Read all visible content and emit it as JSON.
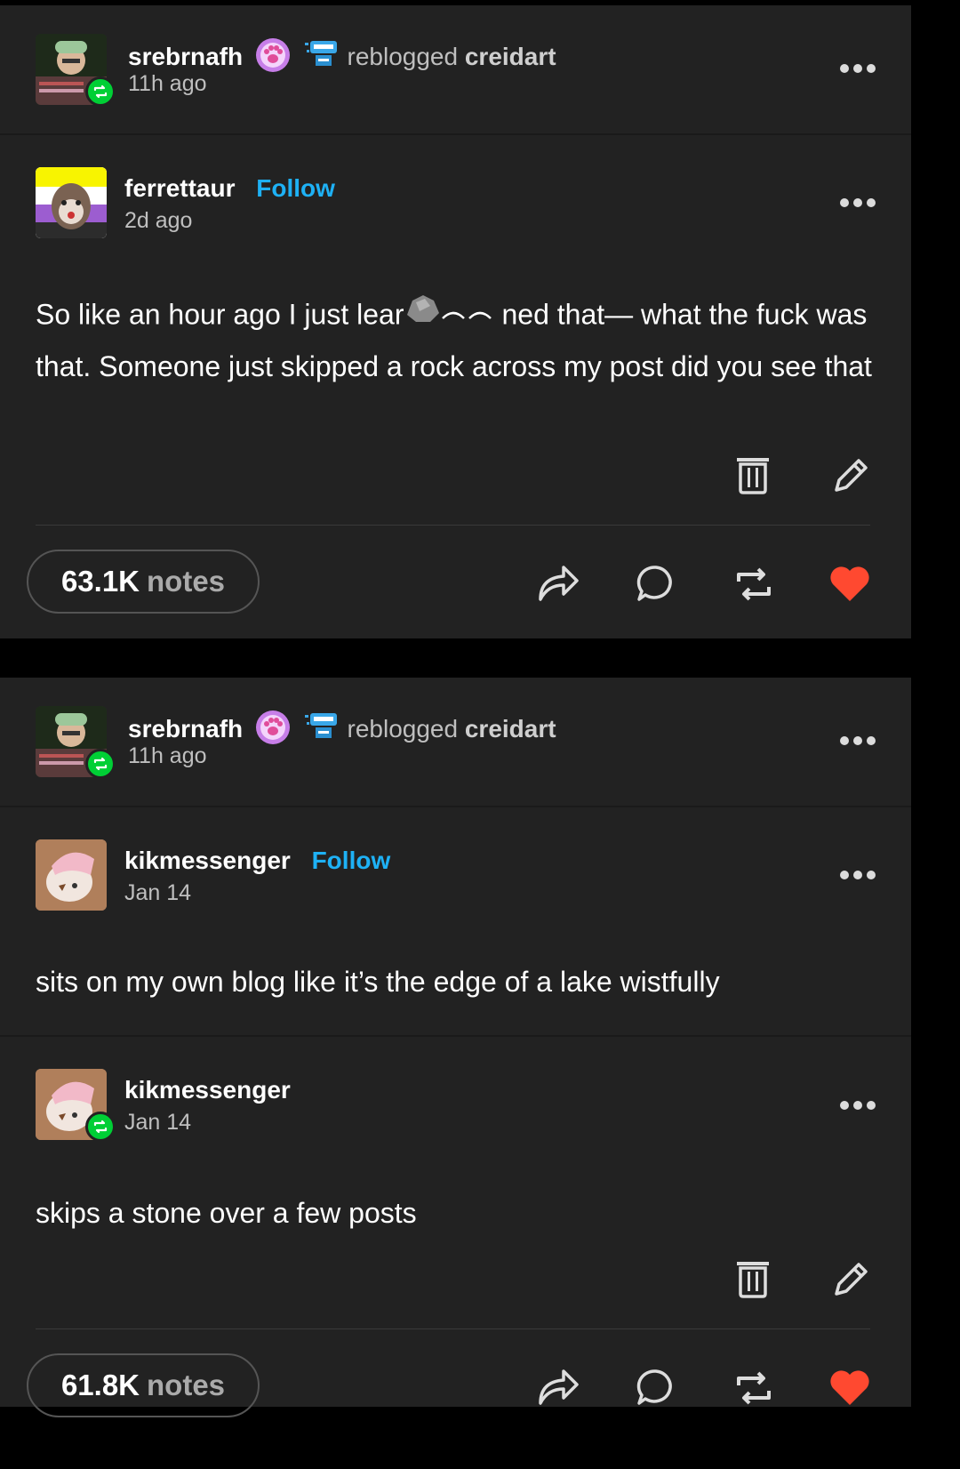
{
  "posts": [
    {
      "reblogger": {
        "name": "srebrnafh",
        "action": "reblogged",
        "source": "creidart",
        "time": "11h ago"
      },
      "original": {
        "name": "ferrettaur",
        "follow": "Follow",
        "time": "2d ago"
      },
      "body_part1": "So like an hour ago I just lear",
      "body_part2": "ned that— what the fuck was that. Someone just skipped a rock across my post did you see that",
      "notes": {
        "count": "63.1K",
        "label": "notes"
      }
    },
    {
      "reblogger": {
        "name": "srebrnafh",
        "action": "reblogged",
        "source": "creidart",
        "time": "11h ago"
      },
      "original": {
        "name": "kikmessenger",
        "follow": "Follow",
        "time": "Jan 14",
        "body": "sits on my own blog like it’s the edge of a lake wistfully"
      },
      "reply": {
        "name": "kikmessenger",
        "time": "Jan 14",
        "body": "skips a stone over a few posts"
      },
      "notes": {
        "count": "61.8K",
        "label": "notes"
      }
    }
  ],
  "colors": {
    "accent_follow": "#1eb1f5",
    "reblog_green": "#00cf35",
    "like_red": "#ff4930",
    "background": "#222222"
  },
  "icons": [
    "more-icon",
    "trash-icon",
    "edit-icon",
    "share-icon",
    "reply-icon",
    "reblog-icon",
    "heart-icon",
    "paw-badge-icon",
    "robot-badge-icon"
  ]
}
